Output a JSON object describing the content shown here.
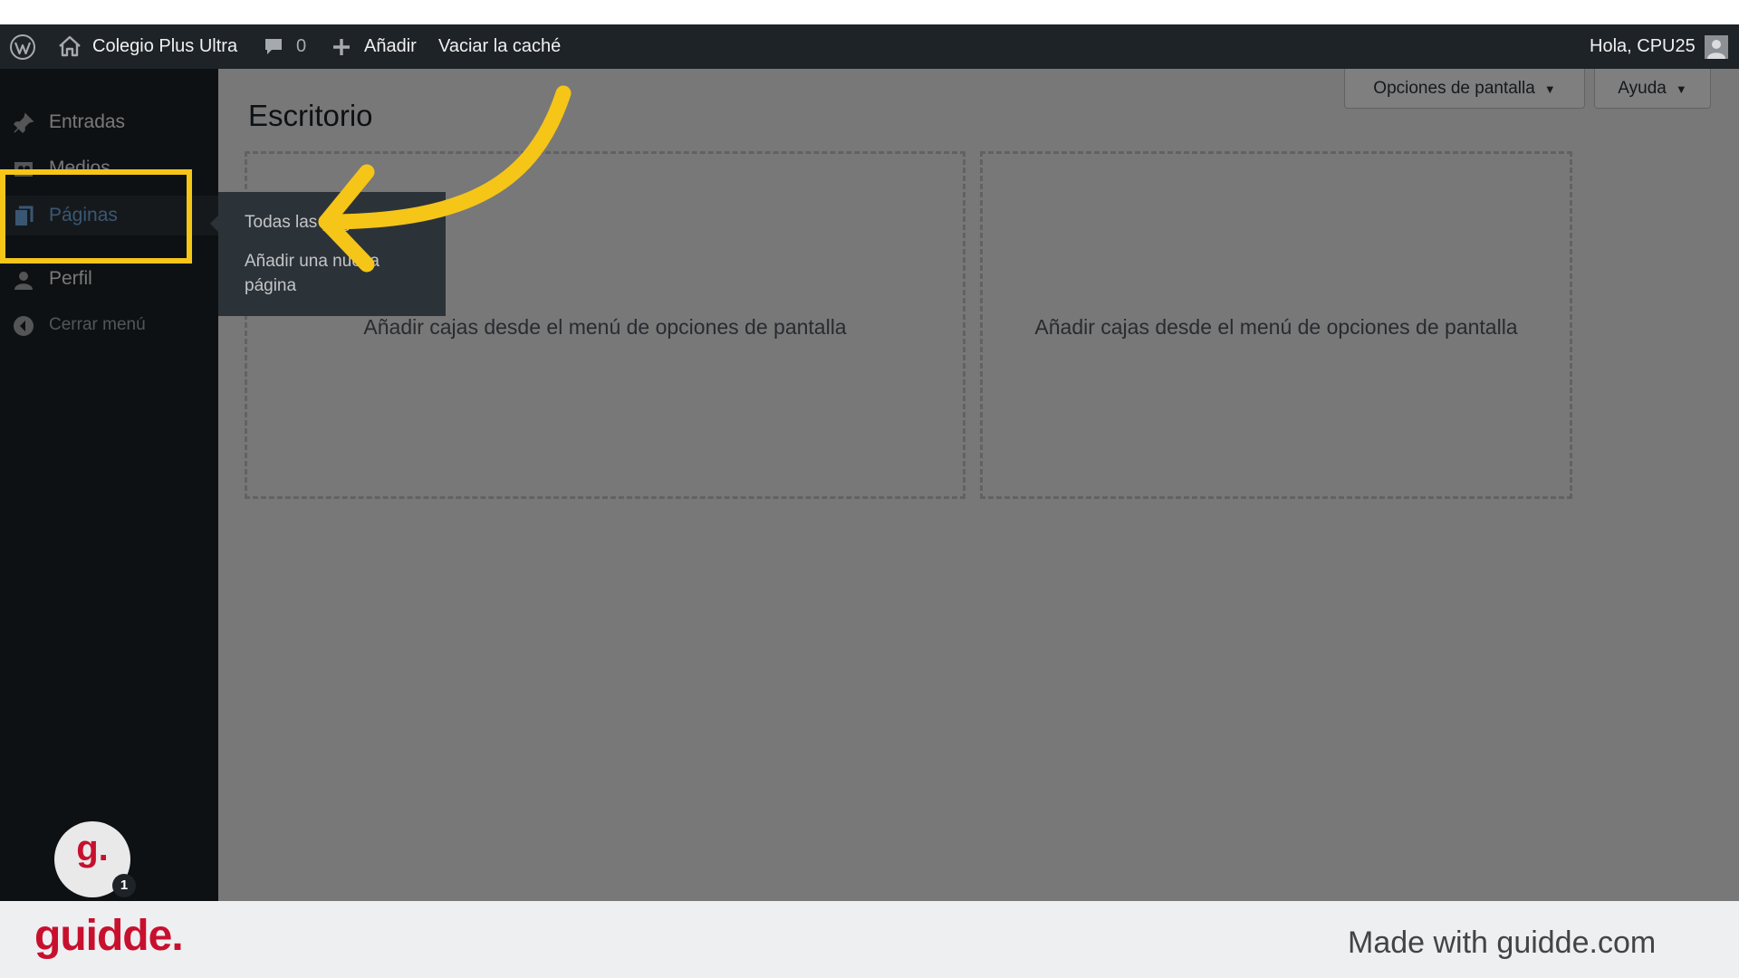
{
  "admin_bar": {
    "site_name": "Colegio Plus Ultra",
    "comments_count": "0",
    "add_new": "Añadir",
    "clear_cache": "Vaciar la caché",
    "greeting": "Hola, CPU25"
  },
  "sidebar": {
    "items": [
      {
        "label": "Entradas",
        "icon": "pin-icon"
      },
      {
        "label": "Medios",
        "icon": "media-icon"
      },
      {
        "label": "Páginas",
        "icon": "pages-icon",
        "active": true
      },
      {
        "label": "Perfil",
        "icon": "user-icon"
      },
      {
        "label": "Cerrar menú",
        "icon": "collapse-icon"
      }
    ]
  },
  "flyout": {
    "items": [
      "Todas las páginas",
      "Añadir una nueva página"
    ]
  },
  "screen_meta": {
    "options_label": "Opciones de pantalla",
    "help_label": "Ayuda"
  },
  "main": {
    "title": "Escritorio",
    "dropzones": [
      {
        "hint": "Añadir cajas desde el menú de opciones de pantalla"
      },
      {
        "hint": "Añadir cajas desde el menú de opciones de pantalla"
      }
    ]
  },
  "guidde": {
    "badge_letter": "g.",
    "badge_count": "1",
    "logo": "guidde.",
    "made_with": "Made with guidde.com"
  },
  "colors": {
    "admin_bar": "#1d2327",
    "accent_active": "#72aee6",
    "highlight": "#f5c518",
    "guidde_red": "#c8102e"
  }
}
